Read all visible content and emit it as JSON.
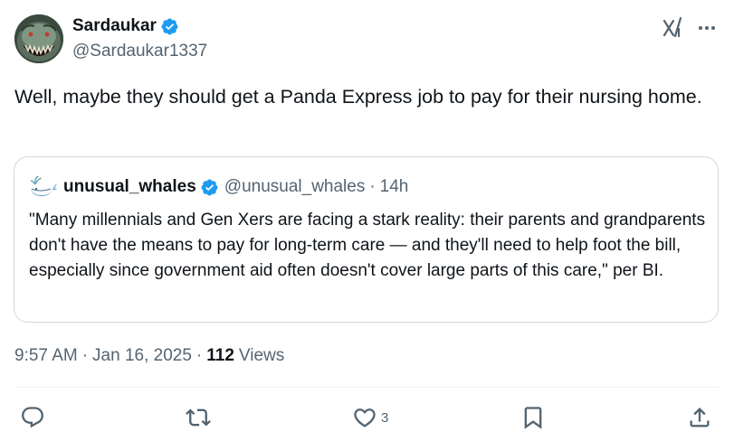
{
  "author": {
    "display_name": "Sardaukar",
    "handle": "@Sardaukar1337",
    "verified": true
  },
  "tweet": {
    "text": "Well, maybe they should get a Panda Express job to pay for their nursing home.",
    "time": "9:57 AM",
    "date": "Jan 16, 2025",
    "views_count": "112",
    "views_label": "Views"
  },
  "quote": {
    "display_name": "unusual_whales",
    "handle": "@unusual_whales",
    "age": "14h",
    "text": "\"Many millennials and Gen Xers are facing a stark reality: their parents and grandparents don't have the means to pay for long-term care — and they'll need to help foot the bill, especially since government aid often doesn't cover large parts of this care,\" per BI."
  },
  "actions": {
    "reply_count": "",
    "retweet_count": "",
    "like_count": "3"
  },
  "icons": {
    "header": [
      "grok-icon",
      "more-icon"
    ],
    "actions": [
      "reply-icon",
      "retweet-icon",
      "like-icon",
      "bookmark-icon",
      "share-icon"
    ]
  },
  "colors": {
    "verified_blue": "#1d9bf0",
    "text_primary": "#0f1419",
    "text_secondary": "#536471",
    "border": "#cfd9de"
  }
}
